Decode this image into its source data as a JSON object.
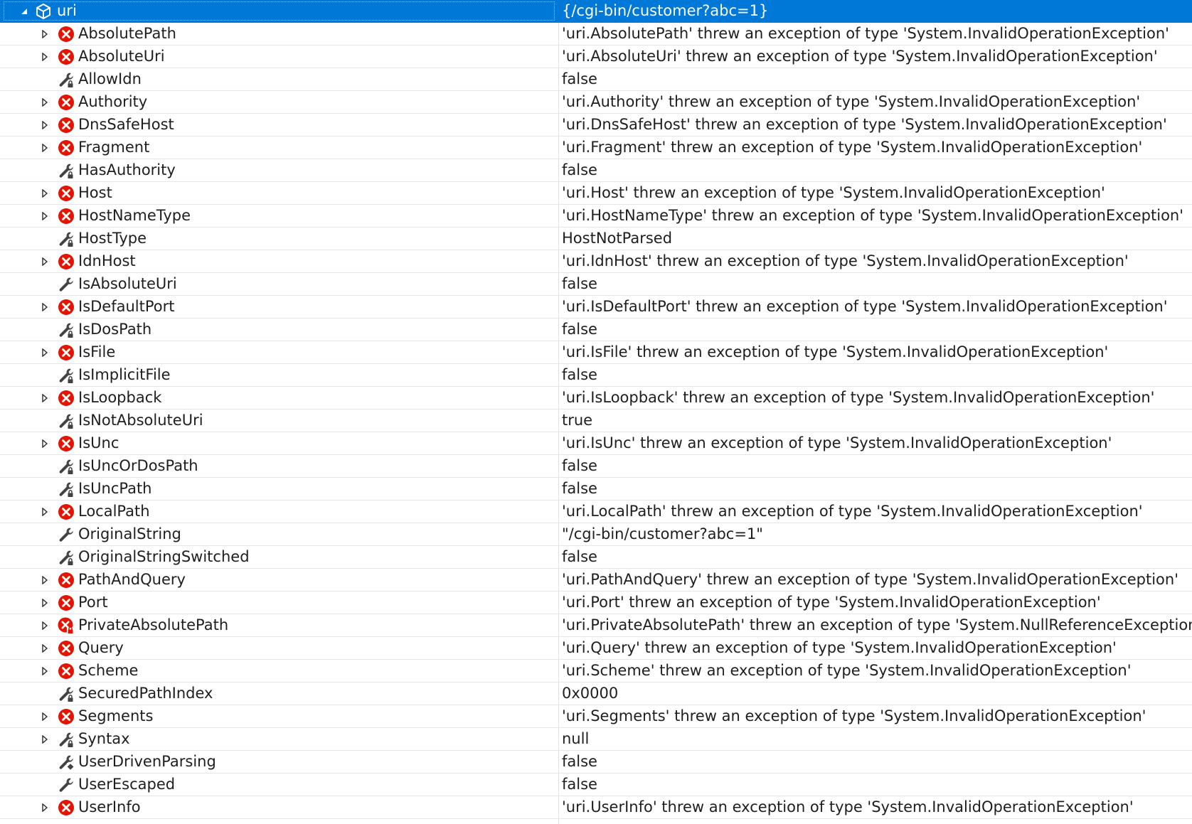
{
  "root": {
    "name": "uri",
    "value": "{/cgi-bin/customer?abc=1}",
    "icon": "object-cube-icon"
  },
  "rows": [
    {
      "name": "AbsolutePath",
      "value": "'uri.AbsolutePath' threw an exception of type 'System.InvalidOperationException'",
      "icon": "error-icon",
      "expandable": true
    },
    {
      "name": "AbsoluteUri",
      "value": "'uri.AbsoluteUri' threw an exception of type 'System.InvalidOperationException'",
      "icon": "error-icon",
      "expandable": true
    },
    {
      "name": "AllowIdn",
      "value": "false",
      "icon": "private-property-wrench-icon",
      "expandable": false
    },
    {
      "name": "Authority",
      "value": "'uri.Authority' threw an exception of type 'System.InvalidOperationException'",
      "icon": "error-icon",
      "expandable": true
    },
    {
      "name": "DnsSafeHost",
      "value": "'uri.DnsSafeHost' threw an exception of type 'System.InvalidOperationException'",
      "icon": "error-icon",
      "expandable": true
    },
    {
      "name": "Fragment",
      "value": "'uri.Fragment' threw an exception of type 'System.InvalidOperationException'",
      "icon": "error-icon",
      "expandable": true
    },
    {
      "name": "HasAuthority",
      "value": "false",
      "icon": "private-property-wrench-icon",
      "expandable": false
    },
    {
      "name": "Host",
      "value": "'uri.Host' threw an exception of type 'System.InvalidOperationException'",
      "icon": "error-icon",
      "expandable": true
    },
    {
      "name": "HostNameType",
      "value": "'uri.HostNameType' threw an exception of type 'System.InvalidOperationException'",
      "icon": "error-icon",
      "expandable": true
    },
    {
      "name": "HostType",
      "value": "HostNotParsed",
      "icon": "private-property-wrench-icon",
      "expandable": false
    },
    {
      "name": "IdnHost",
      "value": "'uri.IdnHost' threw an exception of type 'System.InvalidOperationException'",
      "icon": "error-icon",
      "expandable": true
    },
    {
      "name": "IsAbsoluteUri",
      "value": "false",
      "icon": "property-wrench-icon",
      "expandable": false
    },
    {
      "name": "IsDefaultPort",
      "value": "'uri.IsDefaultPort' threw an exception of type 'System.InvalidOperationException'",
      "icon": "error-icon",
      "expandable": true
    },
    {
      "name": "IsDosPath",
      "value": "false",
      "icon": "private-property-wrench-icon",
      "expandable": false
    },
    {
      "name": "IsFile",
      "value": "'uri.IsFile' threw an exception of type 'System.InvalidOperationException'",
      "icon": "error-icon",
      "expandable": true
    },
    {
      "name": "IsImplicitFile",
      "value": "false",
      "icon": "private-property-wrench-icon",
      "expandable": false
    },
    {
      "name": "IsLoopback",
      "value": "'uri.IsLoopback' threw an exception of type 'System.InvalidOperationException'",
      "icon": "error-icon",
      "expandable": true
    },
    {
      "name": "IsNotAbsoluteUri",
      "value": "true",
      "icon": "private-property-wrench-icon",
      "expandable": false
    },
    {
      "name": "IsUnc",
      "value": "'uri.IsUnc' threw an exception of type 'System.InvalidOperationException'",
      "icon": "error-icon",
      "expandable": true
    },
    {
      "name": "IsUncOrDosPath",
      "value": "false",
      "icon": "private-property-wrench-icon",
      "expandable": false
    },
    {
      "name": "IsUncPath",
      "value": "false",
      "icon": "private-property-wrench-icon",
      "expandable": false
    },
    {
      "name": "LocalPath",
      "value": "'uri.LocalPath' threw an exception of type 'System.InvalidOperationException'",
      "icon": "error-icon",
      "expandable": true
    },
    {
      "name": "OriginalString",
      "value": "\"/cgi-bin/customer?abc=1\"",
      "icon": "property-wrench-icon",
      "expandable": false
    },
    {
      "name": "OriginalStringSwitched",
      "value": "false",
      "icon": "private-property-wrench-icon",
      "expandable": false
    },
    {
      "name": "PathAndQuery",
      "value": "'uri.PathAndQuery' threw an exception of type 'System.InvalidOperationException'",
      "icon": "error-icon",
      "expandable": true
    },
    {
      "name": "Port",
      "value": "'uri.Port' threw an exception of type 'System.InvalidOperationException'",
      "icon": "error-icon",
      "expandable": true
    },
    {
      "name": "PrivateAbsolutePath",
      "value": "'uri.PrivateAbsolutePath' threw an exception of type 'System.NullReferenceException'",
      "icon": "private-error-icon",
      "expandable": true
    },
    {
      "name": "Query",
      "value": "'uri.Query' threw an exception of type 'System.InvalidOperationException'",
      "icon": "error-icon",
      "expandable": true
    },
    {
      "name": "Scheme",
      "value": "'uri.Scheme' threw an exception of type 'System.InvalidOperationException'",
      "icon": "error-icon",
      "expandable": true
    },
    {
      "name": "SecuredPathIndex",
      "value": "0x0000",
      "icon": "private-property-wrench-icon",
      "expandable": false
    },
    {
      "name": "Segments",
      "value": "'uri.Segments' threw an exception of type 'System.InvalidOperationException'",
      "icon": "error-icon",
      "expandable": true
    },
    {
      "name": "Syntax",
      "value": "null",
      "icon": "private-property-wrench-icon",
      "expandable": true
    },
    {
      "name": "UserDrivenParsing",
      "value": "false",
      "icon": "internal-property-wrench-icon",
      "expandable": false
    },
    {
      "name": "UserEscaped",
      "value": "false",
      "icon": "property-wrench-icon",
      "expandable": false
    },
    {
      "name": "UserInfo",
      "value": "'uri.UserInfo' threw an exception of type 'System.InvalidOperationException'",
      "icon": "error-icon",
      "expandable": true
    }
  ],
  "colors": {
    "selection": "#0078d7",
    "error": "#e51400",
    "icon_dark": "#424242",
    "grid_line": "#e6e6e6"
  }
}
